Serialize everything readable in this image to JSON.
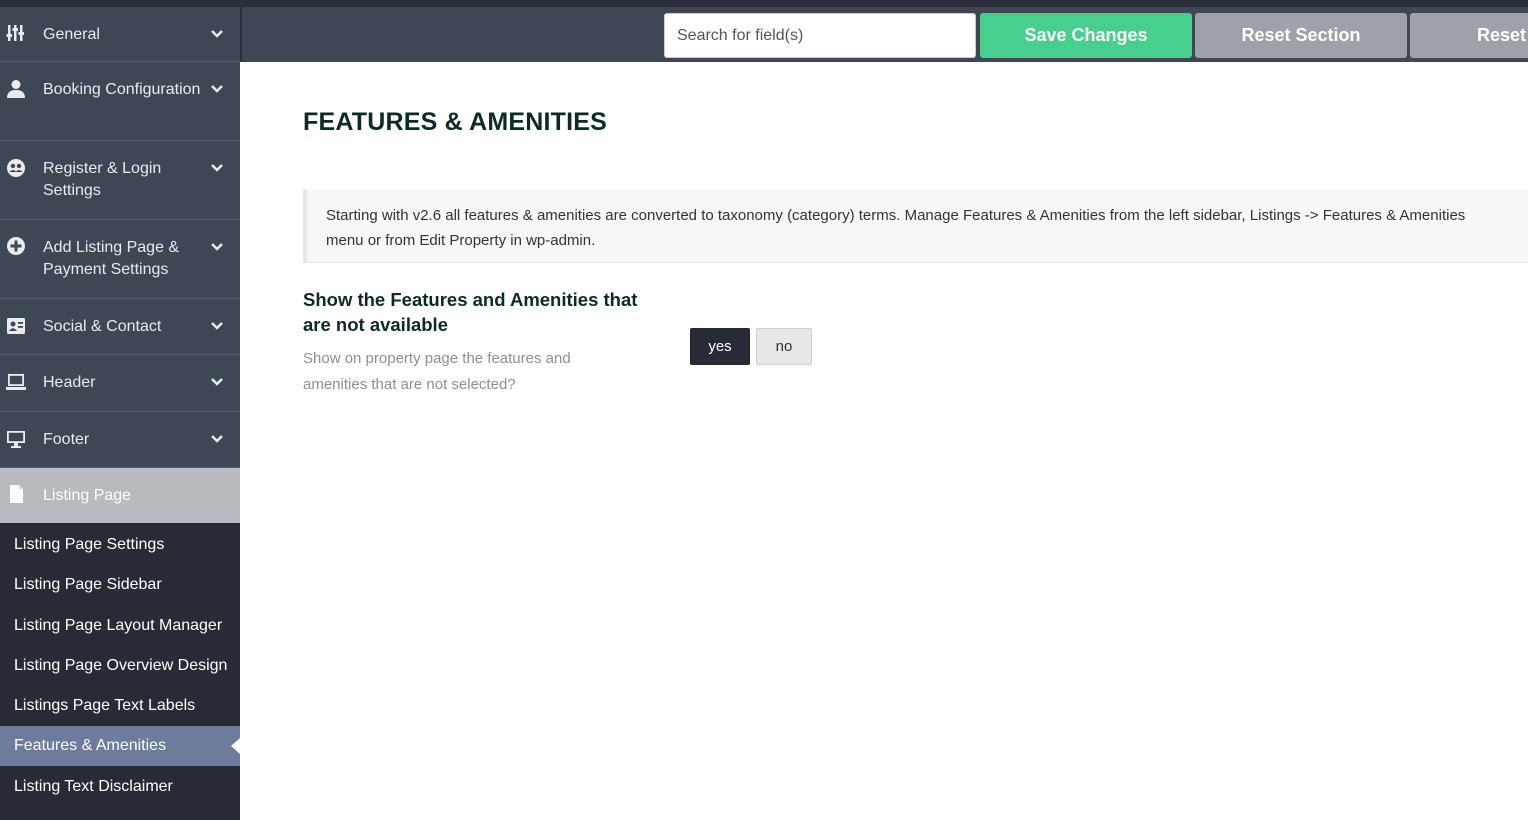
{
  "sidebar": {
    "items": [
      {
        "label": "General",
        "icon": "sliders-icon"
      },
      {
        "label": "Booking Configuration",
        "icon": "user-icon"
      },
      {
        "label": "Register & Login Settings",
        "icon": "users-icon"
      },
      {
        "label": "Add Listing Page & Payment Settings",
        "icon": "plus-circle-icon"
      },
      {
        "label": "Social & Contact",
        "icon": "address-card-icon"
      },
      {
        "label": "Header",
        "icon": "laptop-icon"
      },
      {
        "label": "Footer",
        "icon": "desktop-icon"
      },
      {
        "label": "Listing Page",
        "icon": "file-icon"
      }
    ],
    "submenu": [
      "Listing Page Settings",
      "Listing Page Sidebar",
      "Listing Page Layout Manager",
      "Listing Page Overview Design",
      "Listings Page Text Labels",
      "Features & Amenities",
      "Listing Text Disclaimer"
    ],
    "selected_submenu": "Features & Amenities"
  },
  "toolbar": {
    "search_placeholder": "Search for field(s)",
    "save_label": "Save Changes",
    "reset_section_label": "Reset Section",
    "reset_label": "Reset"
  },
  "main": {
    "title": "FEATURES & AMENITIES",
    "notice": "Starting with v2.6 all features & amenities are converted to taxonomy (category) terms. Manage Features & Amenities from the left sidebar, Listings -> Features & Amenities menu or from Edit Property in wp-admin.",
    "field": {
      "title": "Show the Features and Amenities that are not available",
      "description": "Show on property page the features and amenities that are not selected?",
      "option_yes": "yes",
      "option_no": "no",
      "selected": "yes"
    }
  },
  "colors": {
    "sidebar_bg": "#3f4654",
    "submenu_bg": "#262b36",
    "selected_submenu_bg": "#6d7c9d",
    "save_button": "#47cf8d",
    "reset_button": "#9ea1a7"
  }
}
